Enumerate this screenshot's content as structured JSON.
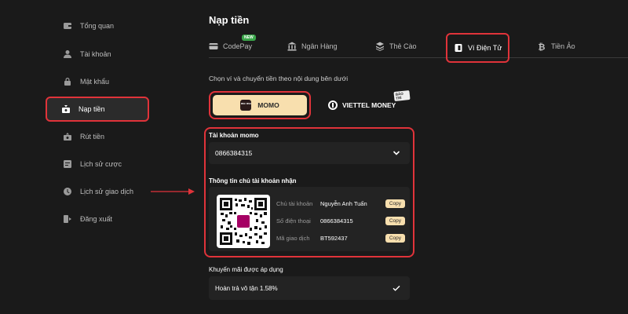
{
  "sidebar": {
    "items": [
      {
        "label": "Tổng quan",
        "icon": "wallet-icon"
      },
      {
        "label": "Tài khoản",
        "icon": "user-icon"
      },
      {
        "label": "Mật khẩu",
        "icon": "lock-icon"
      },
      {
        "label": "Nạp tiền",
        "icon": "deposit-icon",
        "active": true
      },
      {
        "label": "Rút tiền",
        "icon": "withdraw-icon"
      },
      {
        "label": "Lịch sử cược",
        "icon": "bet-history-icon"
      },
      {
        "label": "Lịch sử giao dịch",
        "icon": "transaction-history-icon"
      },
      {
        "label": "Đăng xuất",
        "icon": "logout-icon"
      }
    ]
  },
  "main": {
    "title": "Nạp tiền",
    "tabs": [
      {
        "label": "CodePay",
        "icon": "card-icon",
        "badge": "NEW"
      },
      {
        "label": "Ngân Hàng",
        "icon": "bank-icon"
      },
      {
        "label": "Thẻ Cào",
        "icon": "scratch-card-icon"
      },
      {
        "label": "Ví Điện Tử",
        "icon": "e-wallet-icon",
        "active": true
      },
      {
        "label": "Tiền Ảo",
        "icon": "bitcoin-icon"
      }
    ],
    "instruction": "Chọn ví và chuyển tiền theo nội dung bên dưới",
    "wallets": [
      {
        "label": "MOMO",
        "logo": "mo mo",
        "selected": true
      },
      {
        "label": "VIETTEL MONEY",
        "badge": "BẢO TRÌ"
      }
    ],
    "account": {
      "label": "Tài khoản momo",
      "value": "0866384315"
    },
    "receiver": {
      "label": "Thông tin chủ tài khoản nhận",
      "qr_logo": "mo mo",
      "rows": [
        {
          "label": "Chủ tài khoản",
          "value": "Nguyễn Anh Tuấn",
          "copy": "Copy"
        },
        {
          "label": "Số điện thoại",
          "value": "0866384315",
          "copy": "Copy"
        },
        {
          "label": "Mã giao dịch",
          "value": "BT592437",
          "copy": "Copy"
        }
      ]
    },
    "promo": {
      "label": "Khuyến mãi được áp dụng",
      "item": "Hoàn trả vô tận 1.58%"
    }
  },
  "colors": {
    "background": "#1a1a1a",
    "highlight": "#e0333a",
    "accent": "#f8dfae",
    "panel": "#232323"
  }
}
